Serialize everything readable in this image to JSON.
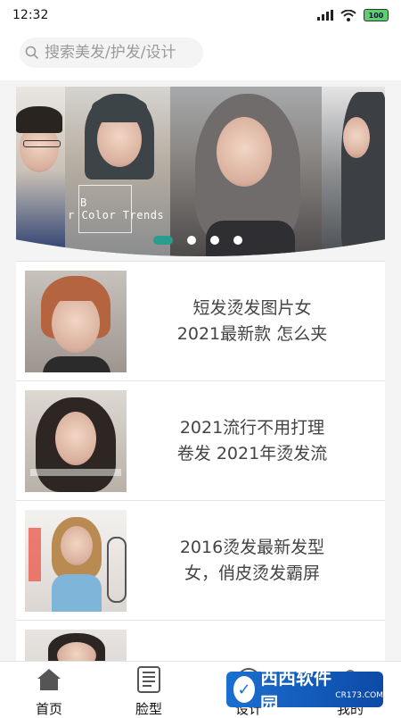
{
  "status_bar": {
    "time": "12:32",
    "battery": "100"
  },
  "search": {
    "placeholder": "搜索美发/护发/设计"
  },
  "banner": {
    "overlay_text": "r Color Trends",
    "overlay_b": "B",
    "dot_count": 4,
    "active_dot": 0
  },
  "articles": [
    {
      "line1": "短发烫发图片女",
      "line2": "2021最新款 怎么夹"
    },
    {
      "line1": "2021流行不用打理",
      "line2": "卷发 2021年烫发流"
    },
    {
      "line1": "2016烫发最新发型",
      "line2": "女，俏皮烫发霸屏"
    }
  ],
  "nav": {
    "home": "首页",
    "face": "脸型",
    "design": "设计",
    "mine": "我的"
  },
  "watermark": {
    "name": "西西软件园",
    "url": "CR173.COM"
  },
  "colors": {
    "accent": "#2a9d8f",
    "bg": "#f4f4f4"
  }
}
